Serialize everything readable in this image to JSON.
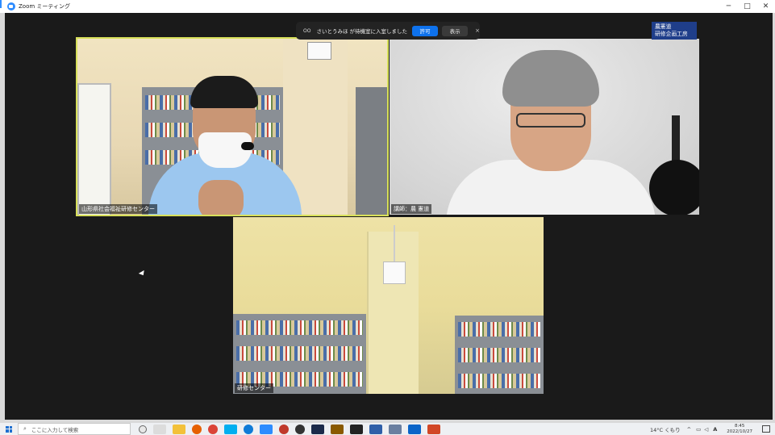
{
  "window": {
    "title": "Zoom ミーティング",
    "minimize": "─",
    "maximize": "□",
    "close": "✕",
    "accent": "#2d8cff"
  },
  "notification": {
    "icon": "OO",
    "message": "さいとうみほ が待機室に入室しました",
    "admit_label": "許可",
    "view_label": "表示",
    "close_label": "×"
  },
  "brand": {
    "line1": "農憲道",
    "line2": "研修企画工房"
  },
  "tiles": [
    {
      "label": "山形県社会福祉研修センター",
      "active_speaker": true
    },
    {
      "label": "講師：農 憲道"
    },
    {
      "label": "研修センター"
    }
  ],
  "taskbar": {
    "search_placeholder": "ここに入力して検索",
    "weather": "14°C くもり",
    "ime": "A",
    "time": "8:45",
    "date": "2022/10/27",
    "search_icon": "search-icon"
  }
}
